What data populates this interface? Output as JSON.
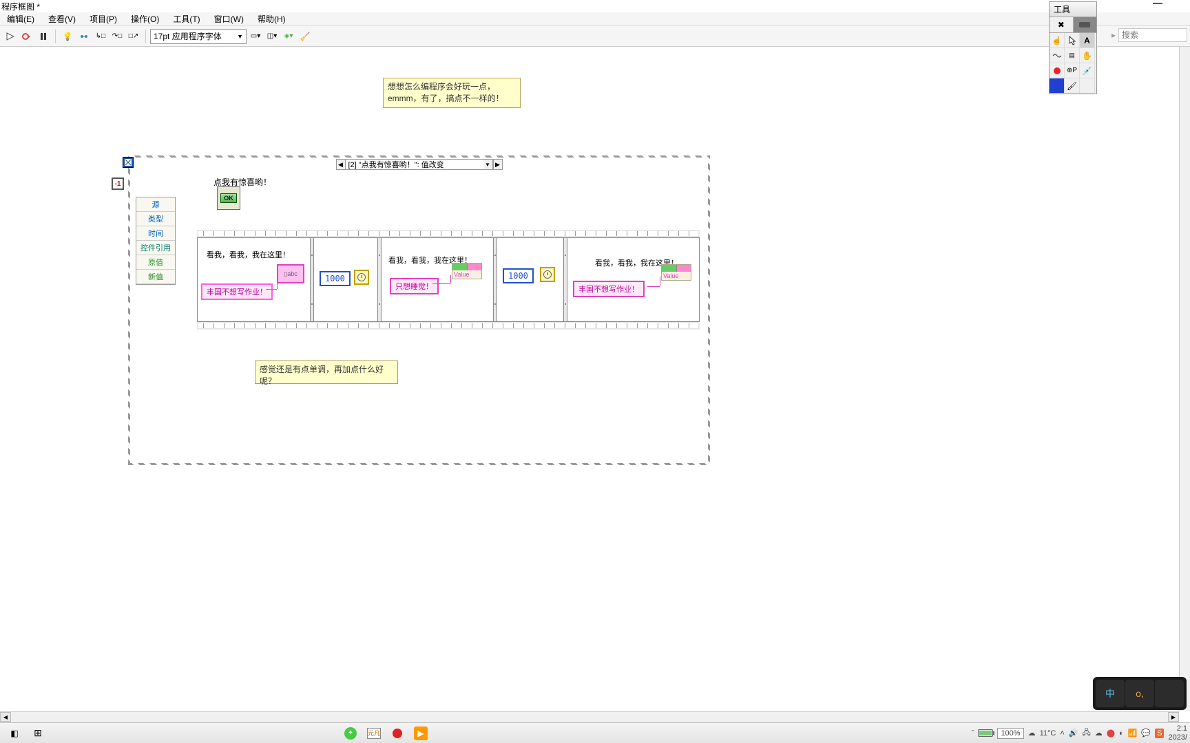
{
  "title": "程序框图 *",
  "menu": [
    "编辑(E)",
    "查看(V)",
    "项目(P)",
    "操作(O)",
    "工具(T)",
    "窗口(W)",
    "帮助(H)"
  ],
  "toolbar": {
    "font": "17pt 应用程序字体"
  },
  "search": {
    "placeholder": "搜索"
  },
  "tools_panel": {
    "title": "工具"
  },
  "comments": {
    "top": "想想怎么编程序会好玩一点，emmm，有了，搞点不一样的！",
    "bottom": "感觉还是有点单调，再加点什么好呢？"
  },
  "event_structure": {
    "terminal": "-1",
    "case": "[2] \"点我有惊喜哟！\": 值改变",
    "cluster": [
      "源",
      "类型",
      "时间",
      "控件引用",
      "原值",
      "新值"
    ],
    "control_label": "点我有惊喜哟！",
    "ok": "OK"
  },
  "sequence": {
    "frame0": {
      "label": "看我，看我，我在这里！",
      "const": "丰国不想写作业！",
      "local": "abc"
    },
    "frame1": {
      "num": "1000"
    },
    "frame2": {
      "label": "看我，看我，我在这里！",
      "const": "只想睡觉！",
      "prop": "Value"
    },
    "frame3": {
      "num": "1000"
    },
    "frame4": {
      "label": "看我，看我，我在这里！",
      "const": "丰国不想写作业！",
      "prop": "Value"
    }
  },
  "tray": {
    "zoom": "100%",
    "temp": "11°C",
    "ime_main": "中",
    "ime_punct": "o,",
    "time": "2:1",
    "date": "2023/"
  }
}
